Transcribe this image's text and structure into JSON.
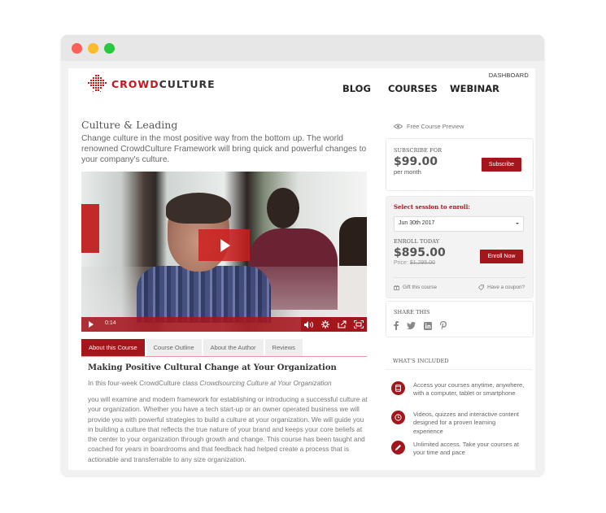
{
  "window": {
    "controls": [
      "close",
      "minimize",
      "maximize"
    ]
  },
  "header": {
    "logo": {
      "part1": "CROWD",
      "part2": "CULTURE"
    },
    "dashboard": "DASHBOARD",
    "nav": [
      "BLOG",
      "COURSES",
      "WEBINAR"
    ]
  },
  "course": {
    "title": "Culture & Leading",
    "description": "Change culture in the most positive way from the bottom up. The world renowned CrowdCulture Framework will bring quick and powerful changes to your company's culture."
  },
  "video": {
    "time": "0:14",
    "controls": [
      "play",
      "volume",
      "settings",
      "share",
      "fullscreen"
    ]
  },
  "tabs": [
    {
      "label": "About this Course",
      "active": true
    },
    {
      "label": "Course Outline",
      "active": false
    },
    {
      "label": "About the Author",
      "active": false
    },
    {
      "label": "Reviews",
      "active": false
    }
  ],
  "about": {
    "heading": "Making Positive Cultural Change at Your Organization",
    "intro_prefix": "In this four-week CrowdCulture class ",
    "intro_italic": "Crowdsourcing Culture at Your Organization",
    "body": "you will examine and modern framework for establishing or introducing a successful culture at your organization. Whether you have a tech start-up or an owner operated business we will provide you with powerful strategies to build a culture at your organization. We will guide you in building a culture that reflects the true nature of your brand and keeps your core beliefs at the center to your organization through growth and change. This course has been taught and coached for years in boardrooms and that feedback had helped create a process that is actionable and transferrable to any size organization."
  },
  "sidebar": {
    "preview_label": "Free Course Preview",
    "subscribe": {
      "caption": "SUBSCRIBE FOR",
      "price": "$99.00",
      "period": "per month",
      "button": "Subscribe"
    },
    "enroll": {
      "select_label": "Select session to enroll:",
      "session_selected": "Jun 30th 2017",
      "caption": "ENROLL TODAY",
      "price": "$895.00",
      "original_label": "Price: ",
      "original_price": "$1,295.00",
      "button": "Enroll Now",
      "gift": "Gift this course",
      "coupon": "Have a coupon?"
    },
    "share": {
      "caption": "SHARE THIS",
      "networks": [
        "facebook",
        "twitter",
        "linkedin",
        "pinterest"
      ]
    },
    "included": {
      "caption": "WHAT'S INCLUDED",
      "items": [
        {
          "icon": "mobile-icon",
          "text": "Access your courses anytime, anywhere, with a computer, tablet or smartphone"
        },
        {
          "icon": "clock-icon",
          "text": "Videos, quizzes and interactive content designed for a proven learning experience"
        },
        {
          "icon": "pencil-icon",
          "text": "Unlimited access. Take your courses at your time and pace"
        }
      ]
    }
  },
  "colors": {
    "brand_red": "#a3161c",
    "logo_red": "#c8161d"
  }
}
